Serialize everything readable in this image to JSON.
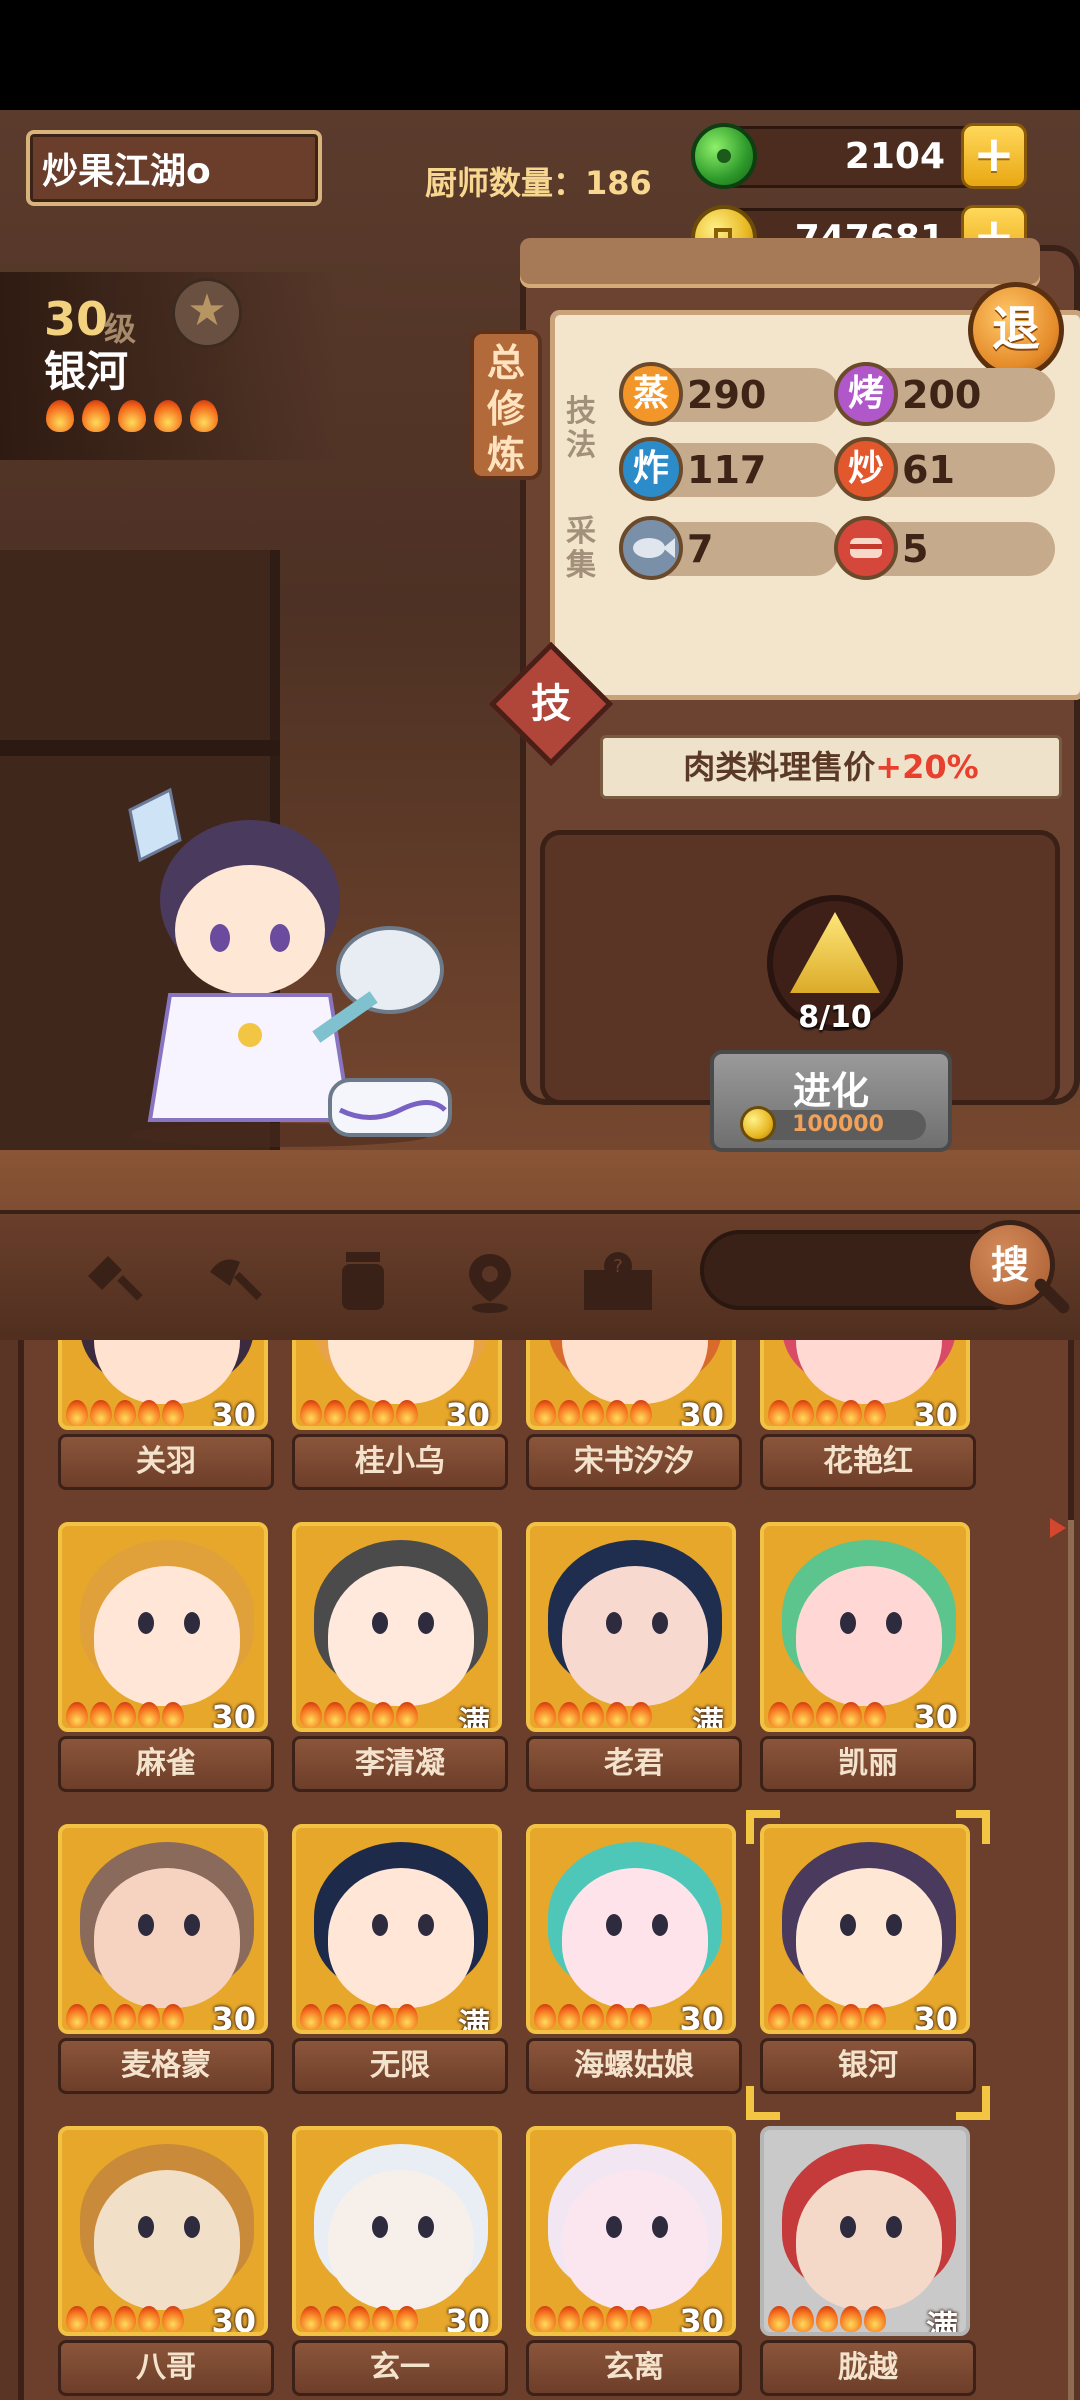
{
  "header": {
    "player_name": "炒果江湖o",
    "chef_count_label": "厨师数量：186",
    "jade_value": "2104",
    "coin_value": "747681",
    "exit_label": "退"
  },
  "chef": {
    "level": "30",
    "level_unit": "级",
    "name": "银河",
    "star_icon": "★",
    "flames": 5
  },
  "training": {
    "tab_label": "总修炼",
    "technique_label": "技法",
    "gather_label": "采集",
    "stats": [
      {
        "icon": "蒸",
        "value": "290"
      },
      {
        "icon": "烤",
        "value": "200"
      },
      {
        "icon": "炸",
        "value": "117"
      },
      {
        "icon": "炒",
        "value": "61"
      },
      {
        "icon": "fish-icon",
        "value": "7"
      },
      {
        "icon": "meat-icon",
        "value": "5"
      }
    ],
    "skill_label": "技",
    "bonus_prefix": "肉类料理售价",
    "bonus_value": "+20%"
  },
  "evolve": {
    "progress": "8/10",
    "button_label": "进化",
    "cost": "100000"
  },
  "toolbar": {
    "search_label": "搜",
    "icons": [
      "shovel-icon",
      "trowel-icon",
      "jar-icon",
      "location-icon",
      "map-question-icon"
    ]
  },
  "chefs_list": [
    {
      "name": "关羽",
      "level": "30"
    },
    {
      "name": "桂小乌",
      "level": "30"
    },
    {
      "name": "宋书汐汐",
      "level": "30"
    },
    {
      "name": "花艳红",
      "level": "30"
    },
    {
      "name": "麻雀",
      "level": "30"
    },
    {
      "name": "李清凝",
      "level": "满"
    },
    {
      "name": "老君",
      "level": "满"
    },
    {
      "name": "凯丽",
      "level": "30"
    },
    {
      "name": "麦格蒙",
      "level": "30"
    },
    {
      "name": "无限",
      "level": "满"
    },
    {
      "name": "海螺姑娘",
      "level": "30"
    },
    {
      "name": "银河",
      "level": "30"
    },
    {
      "name": "八哥",
      "level": "30"
    },
    {
      "name": "玄一",
      "level": "30"
    },
    {
      "name": "玄离",
      "level": "30"
    },
    {
      "name": "胧越",
      "level": "满"
    }
  ]
}
